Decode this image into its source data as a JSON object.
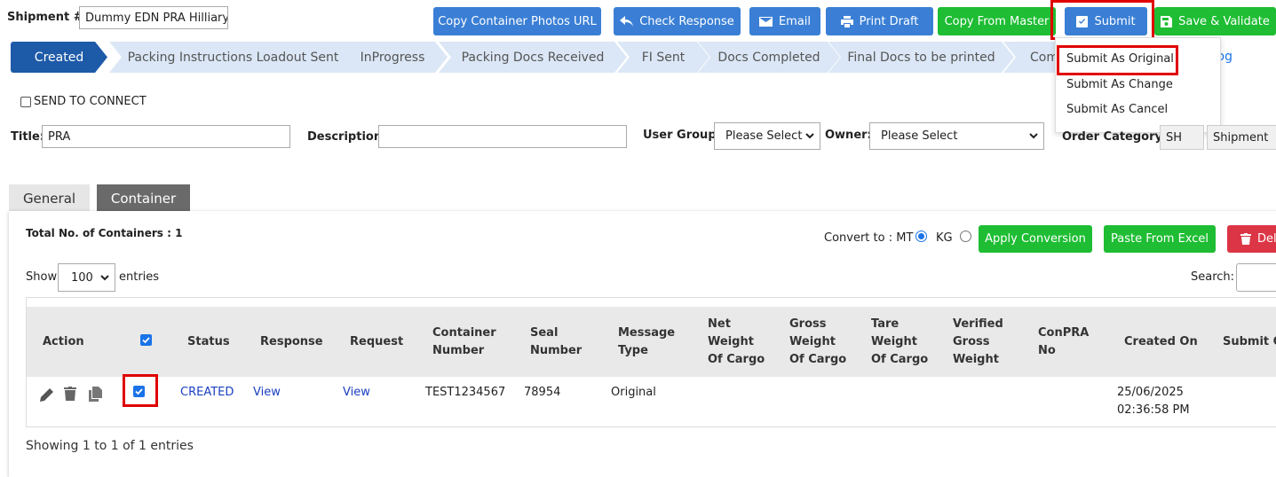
{
  "shipment": {
    "label": "Shipment #:",
    "value": "Dummy EDN PRA Hilliary"
  },
  "toolbar": {
    "copy_photos": "Copy Container Photos URL",
    "check_response": "Check Response",
    "email": "Email",
    "print_draft": "Print Draft",
    "copy_master": "Copy From Master",
    "submit": "Submit",
    "save_validate": "Save & Validate"
  },
  "steps": [
    "Created",
    "Packing Instructions Loadout Sent",
    "InProgress",
    "Packing Docs Received",
    "FI Sent",
    "Docs Completed",
    "Final Docs to be printed",
    "Com"
  ],
  "log_link": "Log",
  "submit_menu": {
    "original": "Submit As Original",
    "change": "Submit As Change",
    "cancel": "Submit As Cancel"
  },
  "send_to_connect": "SEND TO CONNECT",
  "form": {
    "title_label": "Title:",
    "title_value": "PRA",
    "description_label": "Description:",
    "description_value": "",
    "user_group_label": "User Group:",
    "user_group_value": "Please Select",
    "owner_label": "Owner:",
    "owner_value": "Please Select",
    "order_category_label": "Order Category:",
    "order_category_code": "SH",
    "order_category_value": "Shipment"
  },
  "tabs": {
    "general": "General",
    "container": "Container"
  },
  "container": {
    "total": "Total No. of Containers : 1",
    "convert_to": "Convert to : MT",
    "kg": "KG",
    "apply_conversion": "Apply Conversion",
    "paste_excel": "Paste From Excel",
    "delete": "Dele",
    "show": "Show",
    "entries_value": "100",
    "entries": "entries",
    "search": "Search:",
    "footer": "Showing 1 to 1 of 1 entries"
  },
  "table": {
    "headers": {
      "action": "Action",
      "status": "Status",
      "response": "Response",
      "request": "Request",
      "container_number": [
        "Container",
        "Number"
      ],
      "seal_number": [
        "Seal",
        "Number"
      ],
      "message_type": [
        "Message",
        "Type"
      ],
      "net_weight": [
        "Net",
        "Weight",
        "Of Cargo"
      ],
      "gross_weight": [
        "Gross",
        "Weight",
        "Of Cargo"
      ],
      "tare_weight": [
        "Tare",
        "Weight",
        "Of Cargo"
      ],
      "verified_gross": [
        "Verified",
        "Gross",
        "Weight"
      ],
      "conpra": [
        "ConPRA",
        "No"
      ],
      "created_on": "Created On",
      "submit_on": "Submit O"
    },
    "row": {
      "status": "CREATED",
      "response": "View",
      "request": "View",
      "container_number": "TEST1234567",
      "seal_number": "78954",
      "message_type": "Original",
      "created_date": "25/06/2025",
      "created_time": "02:36:58 PM"
    }
  },
  "colors": {
    "primary_blue": "#3a7fd5",
    "active_step": "#1d5aa8",
    "inactive_step": "#dbe7f6",
    "green": "#1ebd33",
    "red": "#dc3545",
    "highlight": "#e00000"
  }
}
